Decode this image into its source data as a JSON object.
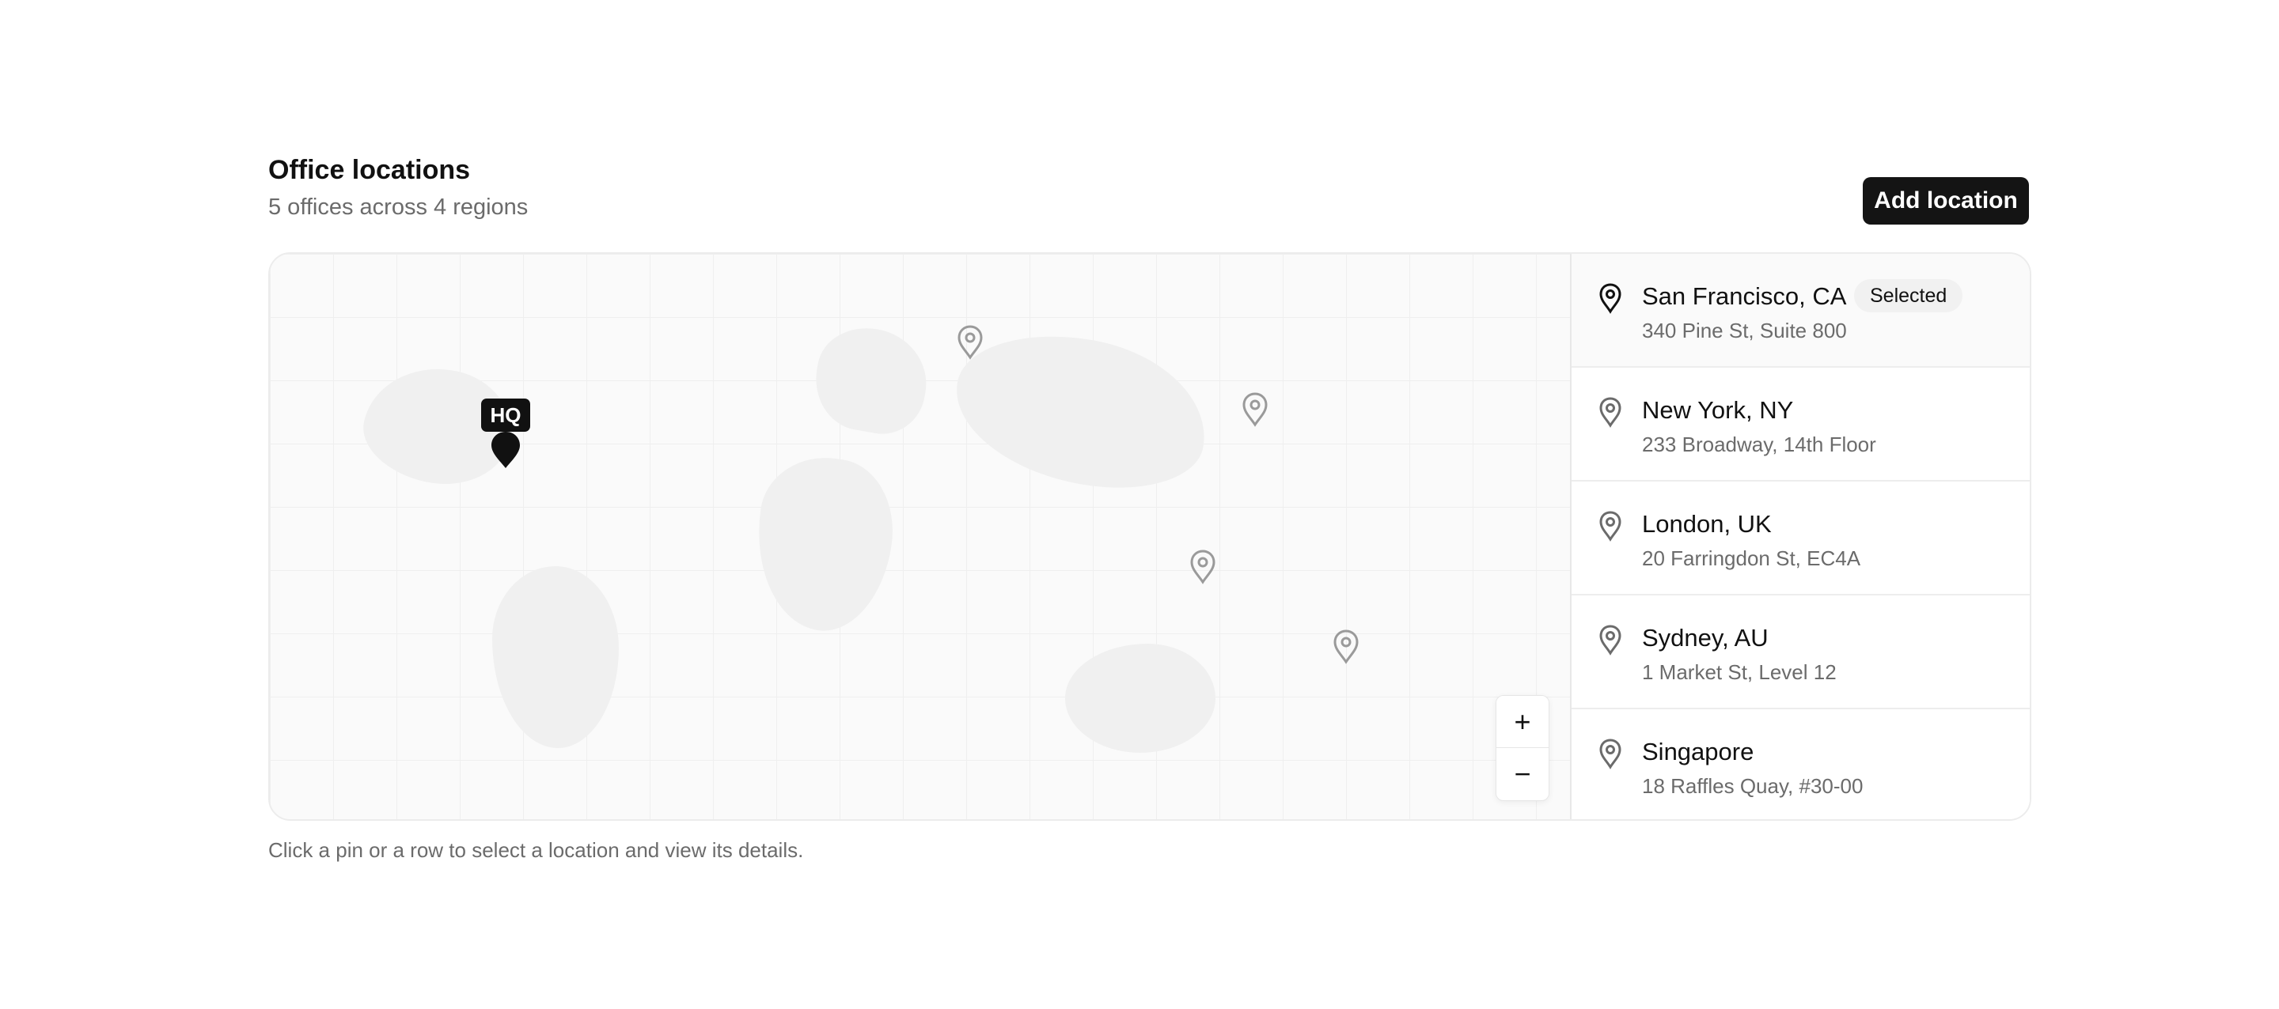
{
  "header": {
    "title": "Office locations",
    "subtitle": "5 offices across 4 regions",
    "add_button_label": "Add location"
  },
  "map": {
    "hq_label": "HQ",
    "zoom_in_label": "+",
    "zoom_out_label": "−",
    "selected_pin_color": "#111111",
    "pin_color": "#9a9a9a"
  },
  "locations": [
    {
      "name": "San Francisco, CA",
      "address": "340 Pine St, Suite 800",
      "badge": "Selected"
    },
    {
      "name": "New York, NY",
      "address": "233 Broadway, 14th Floor"
    },
    {
      "name": "London, UK",
      "address": "20 Farringdon St, EC4A"
    },
    {
      "name": "Sydney, AU",
      "address": "1 Market St, Level 12"
    },
    {
      "name": "Singapore",
      "address": "18 Raffles Quay, #30-00"
    }
  ],
  "footer": {
    "hint": "Click a pin or a row to select a location and view its details."
  }
}
